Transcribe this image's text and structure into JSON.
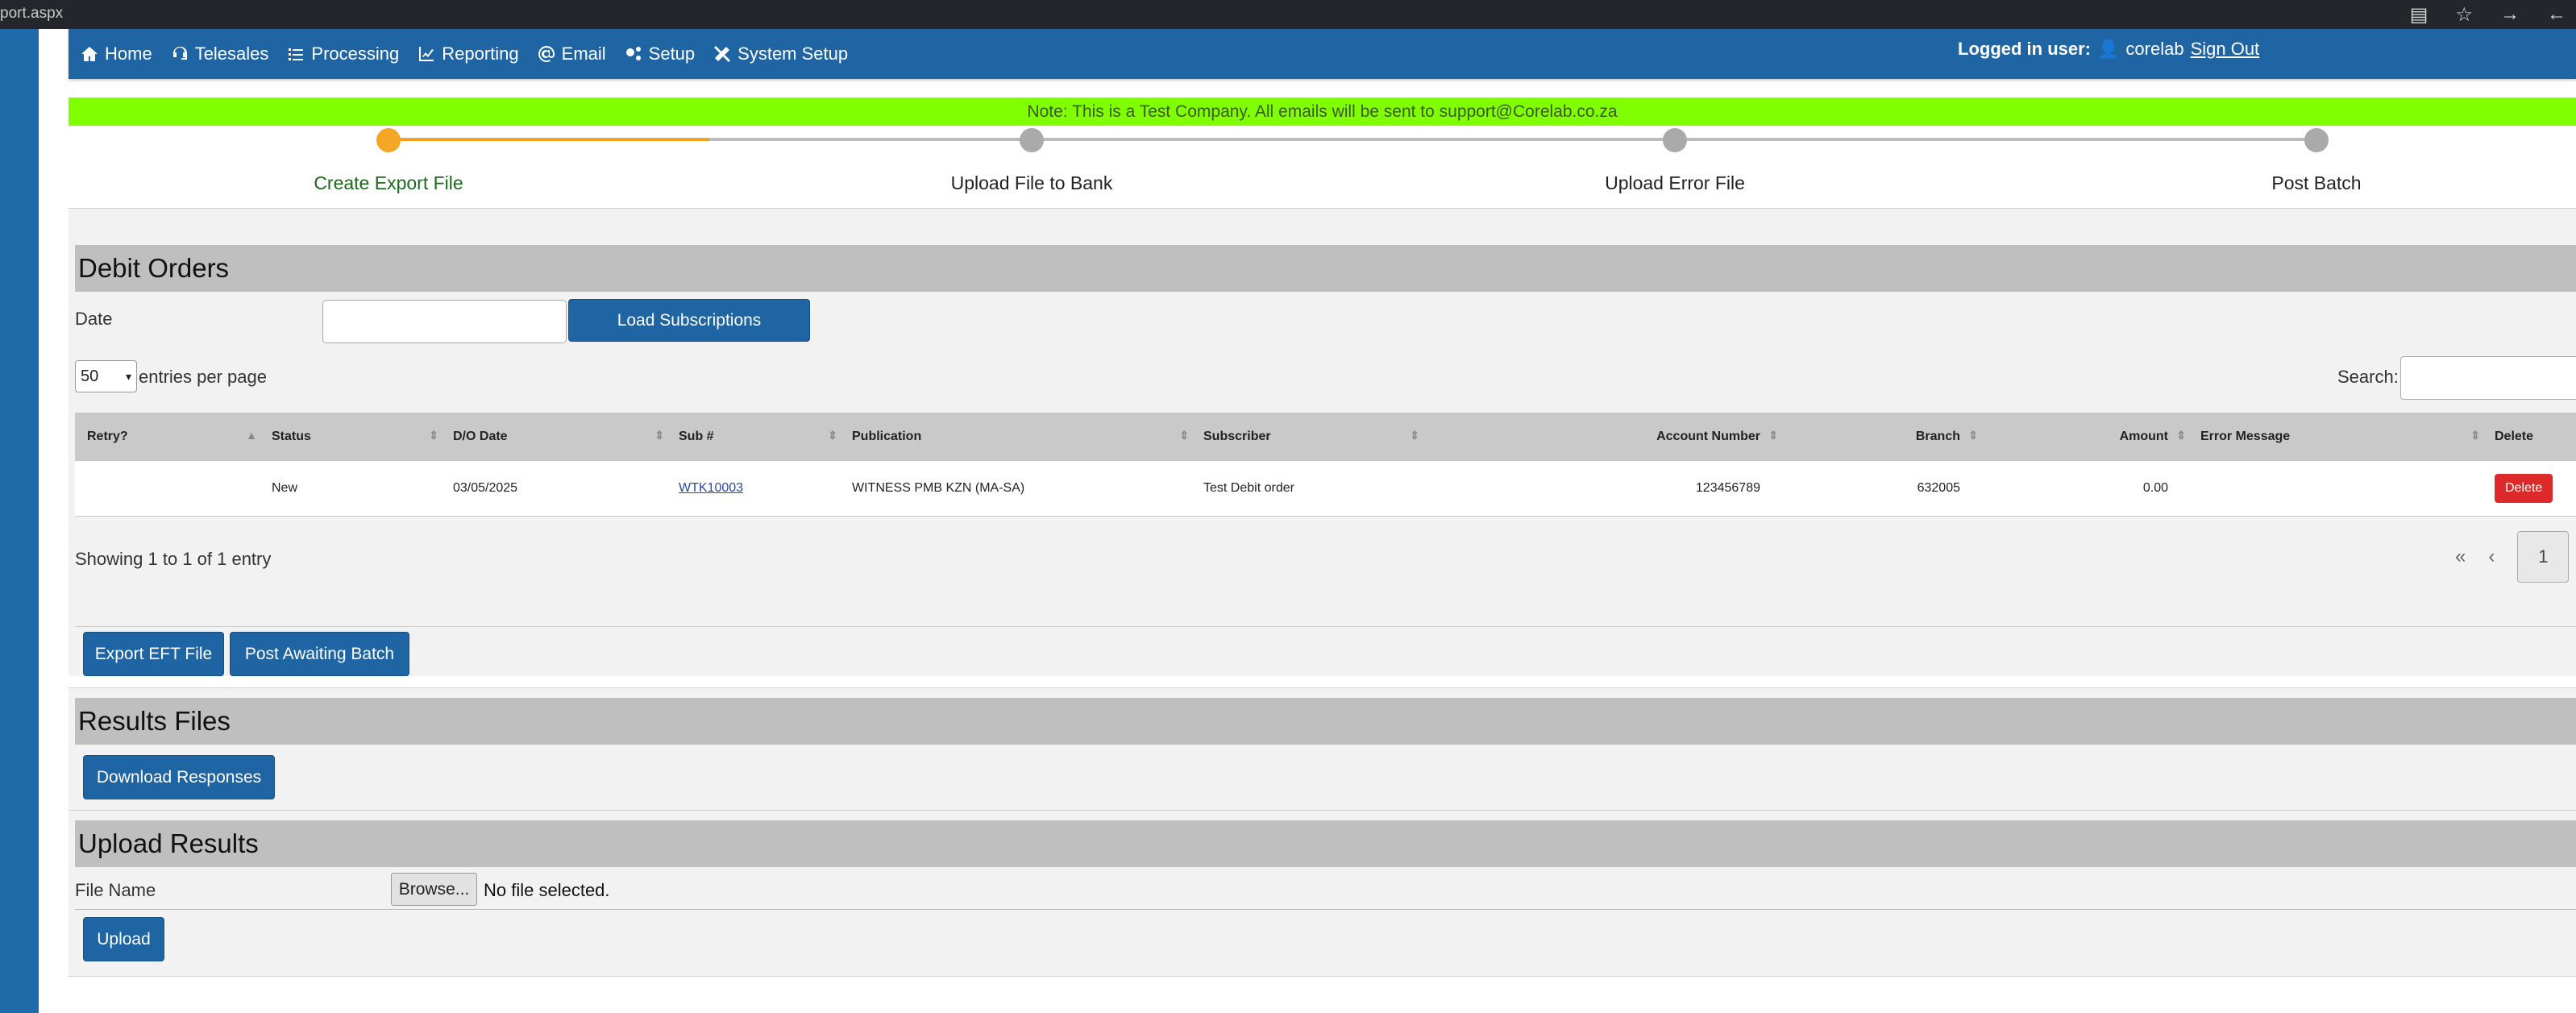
{
  "browser": {
    "url_fragment": "port.aspx"
  },
  "nav": {
    "items": [
      {
        "label": "Home",
        "icon": "home-icon"
      },
      {
        "label": "Telesales",
        "icon": "headset-icon"
      },
      {
        "label": "Processing",
        "icon": "list-icon"
      },
      {
        "label": "Reporting",
        "icon": "chart-icon"
      },
      {
        "label": "Email",
        "icon": "at-icon"
      },
      {
        "label": "Setup",
        "icon": "gears-icon"
      },
      {
        "label": "System Setup",
        "icon": "tools-icon"
      }
    ],
    "logged_in_label": "Logged in user:",
    "user_name": "corelab",
    "signout": "Sign Out"
  },
  "note": "Note: This is a Test Company. All emails will be sent to support@Corelab.co.za",
  "wizard": {
    "steps": [
      "Create Export File",
      "Upload File to Bank",
      "Upload Error File",
      "Post Batch"
    ],
    "active_index": 0
  },
  "debit_orders": {
    "heading": "Debit Orders",
    "date_label": "Date",
    "date_value": "",
    "load_button": "Load Subscriptions",
    "entries_select": "50",
    "entries_label": "entries per page",
    "search_label": "Search:",
    "search_value": "",
    "columns": [
      "Retry?",
      "Status",
      "D/O Date",
      "Sub #",
      "Publication",
      "Subscriber",
      "Account Number",
      "Branch",
      "Amount",
      "Error Message",
      "Delete"
    ],
    "rows": [
      {
        "retry": "",
        "status": "New",
        "do_date": "03/05/2025",
        "sub_no": "WTK10003",
        "publication": "WITNESS PMB KZN (MA-SA)",
        "subscriber": "Test Debit order",
        "account_number": "123456789",
        "branch": "632005",
        "amount": "0.00",
        "error_message": "",
        "delete_label": "Delete"
      }
    ],
    "showing": "Showing 1 to 1 of 1 entry",
    "pagination": {
      "first": "«",
      "prev": "‹",
      "current": "1",
      "next": "›"
    }
  },
  "actions": {
    "export_button": "Export EFT File",
    "post_button": "Post Awaiting Batch"
  },
  "results": {
    "heading": "Results Files",
    "download_button": "Download Responses"
  },
  "upload": {
    "heading": "Upload Results",
    "file_label": "File Name",
    "browse_button": "Browse...",
    "no_file_text": "No file selected.",
    "upload_button": "Upload"
  }
}
